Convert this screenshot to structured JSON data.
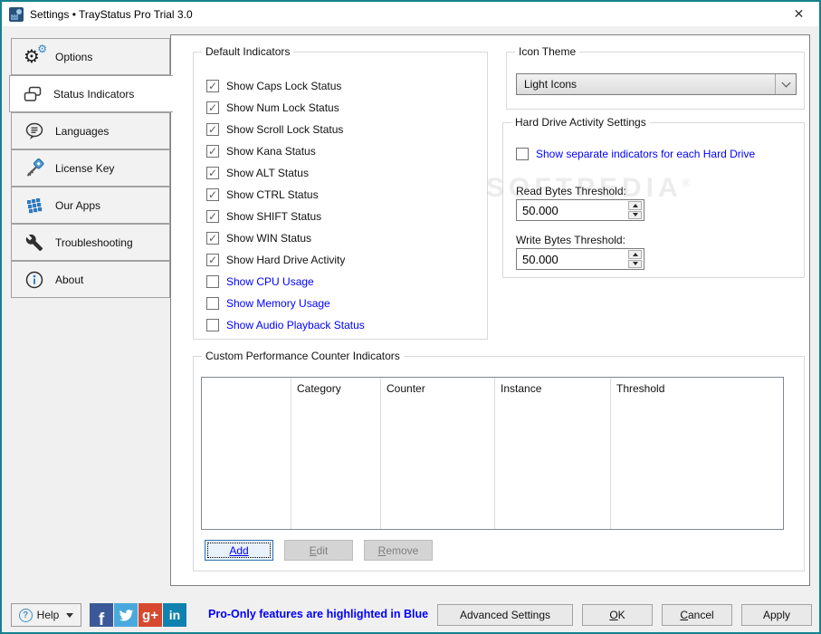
{
  "window": {
    "title": "Settings • TrayStatus Pro Trial 3.0",
    "close_glyph": "✕"
  },
  "sidebar": {
    "items": [
      {
        "label": "Options",
        "icon": "gear-icon",
        "selected": false
      },
      {
        "label": "Status Indicators",
        "icon": "status-indicators-icon",
        "selected": true
      },
      {
        "label": "Languages",
        "icon": "languages-icon",
        "selected": false
      },
      {
        "label": "License Key",
        "icon": "key-icon",
        "selected": false
      },
      {
        "label": "Our Apps",
        "icon": "apps-grid-icon",
        "selected": false
      },
      {
        "label": "Troubleshooting",
        "icon": "wrench-icon",
        "selected": false
      },
      {
        "label": "About",
        "icon": "info-icon",
        "selected": false
      }
    ]
  },
  "panel": {
    "default_indicators": {
      "title": "Default Indicators",
      "items": [
        {
          "label": "Show Caps Lock Status",
          "checked": true,
          "pro": false
        },
        {
          "label": "Show Num Lock Status",
          "checked": true,
          "pro": false
        },
        {
          "label": "Show Scroll Lock Status",
          "checked": true,
          "pro": false
        },
        {
          "label": "Show Kana Status",
          "checked": true,
          "pro": false
        },
        {
          "label": "Show ALT Status",
          "checked": true,
          "pro": false
        },
        {
          "label": "Show CTRL Status",
          "checked": true,
          "pro": false
        },
        {
          "label": "Show SHIFT Status",
          "checked": true,
          "pro": false
        },
        {
          "label": "Show WIN Status",
          "checked": true,
          "pro": false
        },
        {
          "label": "Show Hard Drive Activity",
          "checked": true,
          "pro": false
        },
        {
          "label": "Show CPU Usage",
          "checked": false,
          "pro": true
        },
        {
          "label": "Show Memory Usage",
          "checked": false,
          "pro": true
        },
        {
          "label": "Show Audio Playback Status",
          "checked": false,
          "pro": true
        }
      ]
    },
    "icon_theme": {
      "title": "Icon Theme",
      "selected_option": "Light Icons"
    },
    "hdd_settings": {
      "title": "Hard Drive Activity Settings",
      "separate_checkbox_label": "Show separate indicators for each Hard Drive",
      "separate_checked": false,
      "read_label": "Read Bytes Threshold:",
      "read_value": "50.000",
      "write_label": "Write Bytes Threshold:",
      "write_value": "50.000"
    },
    "custom_counters": {
      "title": "Custom Performance Counter Indicators",
      "columns": [
        "",
        "Category",
        "Counter",
        "Instance",
        "Threshold"
      ],
      "rows": [],
      "add_label": "Add",
      "edit_label": "Edit",
      "remove_label": "Remove"
    },
    "watermark": "SOFTPEDIA"
  },
  "footer": {
    "help_label": "Help",
    "help_glyph": "?",
    "pro_note": "Pro-Only features are highlighted in Blue",
    "advanced_label": "Advanced Settings",
    "ok_label": "OK",
    "cancel_label": "Cancel",
    "apply_label": "Apply",
    "social_icons": [
      "facebook-icon",
      "twitter-icon",
      "googleplus-icon",
      "linkedin-icon"
    ],
    "facebook_glyph": "f",
    "googleplus_glyph": "g+",
    "linkedin_glyph": "in"
  },
  "colors": {
    "pro_blue": "#0000ff",
    "window_border_teal": "#17808d",
    "facebook": "#3b5998",
    "twitter": "#4aa9dc",
    "googleplus": "#d6492f",
    "linkedin": "#1181b0",
    "focused_button_border": "#2a6fb0"
  }
}
